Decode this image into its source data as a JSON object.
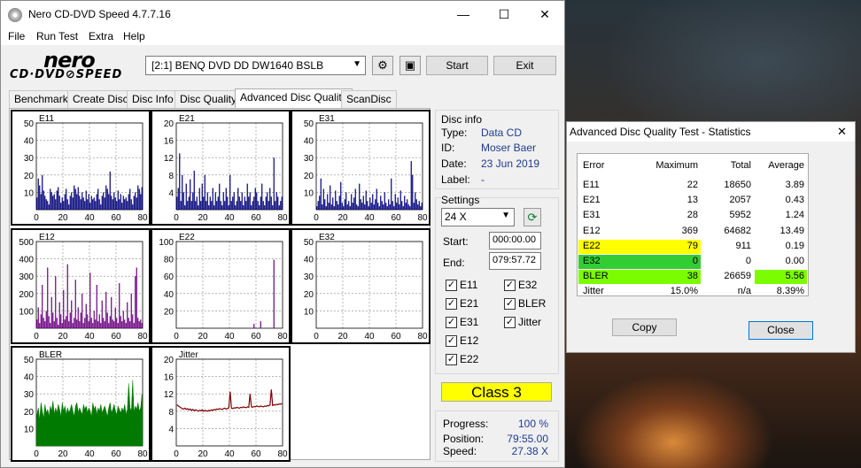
{
  "window": {
    "title": "Nero CD-DVD Speed 4.7.7.16",
    "minimize": "—",
    "maximize": "☐",
    "close": "✕"
  },
  "menu": [
    "File",
    "Run Test",
    "Extra",
    "Help"
  ],
  "logo": {
    "top": "nero",
    "bottom": "CD·DVD⊘SPEED"
  },
  "toolbar": {
    "drive": "[2:1]   BENQ DVD DD DW1640 BSLB",
    "start": "Start",
    "exit": "Exit"
  },
  "tabs": [
    "Benchmark",
    "Create Disc",
    "Disc Info",
    "Disc Quality",
    "Advanced Disc Quality",
    "ScanDisc"
  ],
  "active_tab": "Advanced Disc Quality",
  "charts": [
    {
      "name": "E11",
      "ylim": [
        0,
        50
      ],
      "yticks": [
        "50",
        "40",
        "30",
        "20",
        "10"
      ],
      "color": "#00007a",
      "values": [
        7,
        18,
        14,
        9,
        20,
        11,
        8,
        6,
        5,
        3,
        12,
        10,
        8,
        9,
        6,
        11,
        13,
        8,
        4,
        7,
        5,
        9,
        12,
        6,
        3,
        8,
        10,
        7,
        14,
        12,
        9,
        13,
        8,
        6,
        10,
        7,
        5,
        11,
        6,
        9,
        4,
        8,
        6,
        7,
        5,
        9,
        12,
        6,
        3,
        8,
        10,
        7,
        14,
        12,
        9,
        22,
        8,
        6,
        10,
        7,
        5,
        11,
        6,
        9,
        4,
        8,
        6,
        7,
        5,
        9,
        12,
        6,
        3,
        8,
        10,
        7,
        14,
        12,
        9,
        13
      ]
    },
    {
      "name": "E21",
      "ylim": [
        0,
        20
      ],
      "yticks": [
        "20",
        "16",
        "12",
        "8",
        "4"
      ],
      "color": "#00007a",
      "values": [
        3,
        5,
        13,
        2,
        8,
        4,
        1,
        6,
        2,
        3,
        7,
        2,
        4,
        9,
        2,
        3,
        1,
        5,
        2,
        6,
        3,
        8,
        2,
        4,
        1,
        3,
        2,
        5,
        1,
        4,
        2,
        3,
        6,
        2,
        1,
        4,
        2,
        5,
        3,
        1,
        8,
        2,
        3,
        4,
        1,
        2,
        5,
        3,
        2,
        4,
        1,
        3,
        2,
        6,
        3,
        4,
        1,
        2,
        3,
        5,
        4,
        2,
        1,
        3,
        6,
        2,
        1,
        3,
        4,
        2,
        5,
        3,
        1,
        12,
        2,
        4,
        3,
        1,
        2,
        3
      ]
    },
    {
      "name": "E31",
      "ylim": [
        0,
        50
      ],
      "yticks": [
        "50",
        "40",
        "30",
        "20",
        "10"
      ],
      "color": "#00007a",
      "values": [
        2,
        5,
        8,
        18,
        3,
        12,
        6,
        2,
        9,
        4,
        14,
        3,
        7,
        2,
        11,
        5,
        3,
        8,
        16,
        4,
        2,
        6,
        10,
        3,
        5,
        2,
        9,
        4,
        7,
        12,
        3,
        2,
        15,
        6,
        4,
        8,
        3,
        11,
        5,
        2,
        7,
        4,
        9,
        3,
        6,
        12,
        4,
        2,
        8,
        5,
        3,
        10,
        4,
        2,
        6,
        3,
        18,
        5,
        2,
        9,
        4,
        7,
        3,
        11,
        5,
        2,
        8,
        4,
        6,
        3,
        2,
        28,
        20,
        4,
        10,
        6,
        3,
        5,
        2,
        4
      ]
    },
    {
      "name": "E12",
      "ylim": [
        0,
        500
      ],
      "yticks": [
        "500",
        "400",
        "300",
        "200",
        "100"
      ],
      "color": "#6a0080",
      "values": [
        50,
        120,
        30,
        80,
        250,
        60,
        40,
        100,
        350,
        70,
        30,
        180,
        90,
        40,
        300,
        60,
        20,
        150,
        80,
        30,
        220,
        50,
        70,
        369,
        40,
        90,
        160,
        30,
        60,
        280,
        50,
        120,
        40,
        90,
        200,
        30,
        60,
        140,
        80,
        40,
        320,
        60,
        30,
        100,
        50,
        250,
        40,
        80,
        30,
        160,
        60,
        40,
        210,
        90,
        30,
        70,
        180,
        50,
        40,
        120,
        60,
        30,
        260,
        70,
        40,
        100,
        50,
        30,
        150,
        60,
        40,
        200,
        80,
        30,
        300,
        350,
        60,
        40,
        50,
        30
      ]
    },
    {
      "name": "E22",
      "ylim": [
        0,
        100
      ],
      "yticks": [
        "100",
        "80",
        "60",
        "40",
        "20"
      ],
      "color": "#6a0080",
      "values": [
        0,
        0,
        0,
        0,
        0,
        0,
        0,
        0,
        0,
        0,
        0,
        0,
        0,
        0,
        0,
        0,
        0,
        0,
        0,
        0,
        0,
        0,
        0,
        0,
        0,
        0,
        0,
        0,
        0,
        0,
        0,
        0,
        0,
        0,
        0,
        0,
        0,
        0,
        0,
        0,
        0,
        0,
        0,
        0,
        0,
        0,
        0,
        0,
        0,
        0,
        0,
        0,
        0,
        0,
        0,
        0,
        0,
        0,
        5,
        0,
        0,
        0,
        0,
        8,
        0,
        0,
        0,
        0,
        0,
        0,
        0,
        0,
        0,
        79,
        0,
        0,
        0,
        0,
        0,
        0
      ]
    },
    {
      "name": "E32",
      "ylim": [
        0,
        50
      ],
      "yticks": [
        "50",
        "40",
        "30",
        "20",
        "10"
      ],
      "color": "#6a0080",
      "values": [
        0
      ]
    },
    {
      "name": "BLER",
      "ylim": [
        0,
        50
      ],
      "yticks": [
        "50",
        "40",
        "30",
        "20",
        "10"
      ],
      "color": "#007a00",
      "values": [
        18,
        22,
        15,
        25,
        20,
        16,
        24,
        19,
        21,
        17,
        23,
        20,
        26,
        18,
        22,
        19,
        24,
        21,
        17,
        25,
        20,
        23,
        18,
        22,
        19,
        21,
        24,
        20,
        17,
        23,
        25,
        19,
        22,
        20,
        18,
        24,
        21,
        23,
        19,
        22,
        20,
        17,
        25,
        21,
        23,
        18,
        22,
        20,
        24,
        19,
        21,
        23,
        20,
        17,
        22,
        25,
        19,
        21,
        24,
        20,
        18,
        23,
        21,
        19,
        22,
        20,
        24,
        18,
        21,
        36,
        22,
        20,
        38,
        19,
        23,
        21,
        25,
        20,
        22,
        30
      ]
    },
    {
      "name": "Jitter",
      "ylim": [
        0,
        20
      ],
      "yticks": [
        "20",
        "16",
        "12",
        "8",
        "4"
      ],
      "color": "#800000",
      "values": [
        9.5,
        9.2,
        9.0,
        8.8,
        8.6,
        8.5,
        8.7,
        8.4,
        8.6,
        8.3,
        8.5,
        8.2,
        8.4,
        8.1,
        8.3,
        8.2,
        8.0,
        8.2,
        8.1,
        8.3,
        8.0,
        8.2,
        8.1,
        8.0,
        8.2,
        8.1,
        8.3,
        8.2,
        8.4,
        8.3,
        8.5,
        8.4,
        8.6,
        8.5,
        8.4,
        8.6,
        8.7,
        8.5,
        8.6,
        8.8,
        12.5,
        8.7,
        8.6,
        8.8,
        8.7,
        8.9,
        8.8,
        8.7,
        8.9,
        8.8,
        9.0,
        8.9,
        8.8,
        9.0,
        8.9,
        12.0,
        9.0,
        8.9,
        9.1,
        9.0,
        9.2,
        9.1,
        9.0,
        9.2,
        9.1,
        9.0,
        9.2,
        9.1,
        9.3,
        9.2,
        9.4,
        13.0,
        9.3,
        9.5,
        9.4,
        9.6,
        9.5,
        9.7,
        9.6,
        9.8
      ]
    }
  ],
  "xticks": [
    "0",
    "20",
    "40",
    "60",
    "80"
  ],
  "disc_info": {
    "header": "Disc info",
    "type_label": "Type:",
    "type": "Data CD",
    "id_label": "ID:",
    "id": "Moser Baer",
    "date_label": "Date:",
    "date": "23 Jun 2019",
    "label_label": "Label:",
    "label": "-"
  },
  "settings": {
    "header": "Settings",
    "speed": "24 X",
    "start_label": "Start:",
    "start": "000:00.00",
    "end_label": "End:",
    "end": "079:57.72",
    "checks_left": [
      "E11",
      "E21",
      "E31",
      "E12",
      "E22"
    ],
    "checks_right": [
      "E32",
      "BLER",
      "Jitter"
    ]
  },
  "class_label": "Class 3",
  "progress": {
    "progress_label": "Progress:",
    "progress": "100 %",
    "position_label": "Position:",
    "position": "79:55.00",
    "speed_label": "Speed:",
    "speed": "27.38 X"
  },
  "stats": {
    "title": "Advanced Disc Quality Test - Statistics",
    "close": "✕",
    "headers": [
      "Error",
      "Maximum",
      "Total",
      "Average"
    ],
    "rows": [
      {
        "error": "E11",
        "maximum": "22",
        "total": "18650",
        "average": "3.89"
      },
      {
        "error": "E21",
        "maximum": "13",
        "total": "2057",
        "average": "0.43"
      },
      {
        "error": "E31",
        "maximum": "28",
        "total": "5952",
        "average": "1.24"
      },
      {
        "error": "E12",
        "maximum": "369",
        "total": "64682",
        "average": "13.49"
      },
      {
        "error": "E22",
        "maximum": "79",
        "total": "911",
        "average": "0.19"
      },
      {
        "error": "E32",
        "maximum": "0",
        "total": "0",
        "average": "0.00"
      },
      {
        "error": "BLER",
        "maximum": "38",
        "total": "26659",
        "average": "5.56"
      },
      {
        "error": "Jitter",
        "maximum": "15.0%",
        "total": "n/a",
        "average": "8.39%"
      }
    ],
    "copy": "Copy",
    "close_btn": "Close"
  },
  "colors": {
    "yellow": "#ffff00",
    "green": "#32cd32",
    "lime": "#7cfc00"
  }
}
